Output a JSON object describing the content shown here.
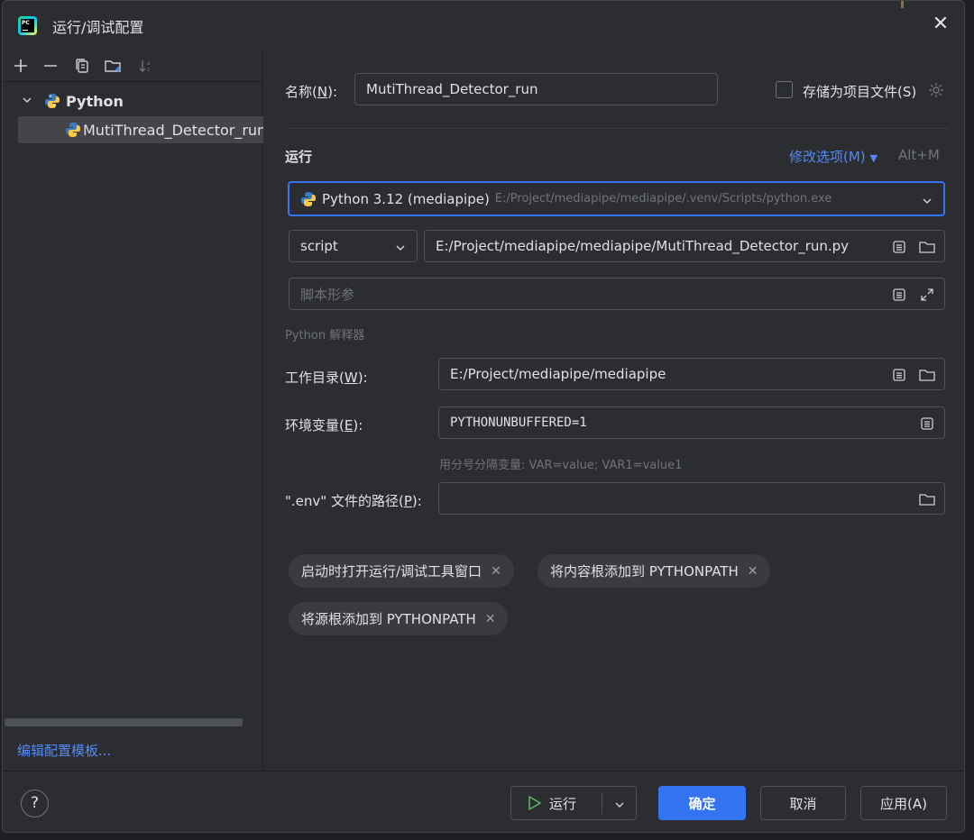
{
  "window": {
    "title": "运行/调试配置"
  },
  "sidebar": {
    "toolbar": [
      "add",
      "remove",
      "copy",
      "new-folder",
      "sort"
    ],
    "tree": [
      {
        "label": "Python",
        "expanded": true,
        "level": 0
      },
      {
        "label": "MutiThread_Detector_run",
        "selected": true,
        "level": 1
      }
    ],
    "edit_templates": "编辑配置模板..."
  },
  "form": {
    "name_label_pre": "名称(",
    "name_label_key": "N",
    "name_label_post": "):",
    "name_value": "MutiThread_Detector_run",
    "store_label": "存储为项目文件(S)",
    "run_section": "运行",
    "modify_options": "修改选项(M)",
    "modify_shortcut": "Alt+M",
    "interpreter_name": "Python 3.12 (mediapipe)",
    "interpreter_path": "E:/Project/mediapipe/mediapipe/.venv/Scripts/python.exe",
    "script_type": "script",
    "script_path": "E:/Project/mediapipe/mediapipe/MutiThread_Detector_run.py",
    "script_params_placeholder": "脚本形参",
    "interpreter_hint": "Python 解释器",
    "workdir_label_pre": "工作目录(",
    "workdir_label_key": "W",
    "workdir_label_post": "):",
    "workdir_value": "E:/Project/mediapipe/mediapipe",
    "env_label_pre": "环境变量(",
    "env_label_key": "E",
    "env_label_post": "):",
    "env_value": "PYTHONUNBUFFERED=1",
    "env_hint": "用分号分隔变量: VAR=value; VAR1=value1",
    "dotenv_label_pre": "\".env\" 文件的路径(",
    "dotenv_label_key": "P",
    "dotenv_label_post": "):",
    "dotenv_value": "",
    "chips": [
      "启动时打开运行/调试工具窗口",
      "将内容根添加到 PYTHONPATH",
      "将源根添加到 PYTHONPATH"
    ]
  },
  "footer": {
    "help": "?",
    "run": "运行",
    "ok": "确定",
    "cancel": "取消",
    "apply": "应用(A)"
  },
  "colors": {
    "accent": "#3574f0",
    "link": "#548af7",
    "bg": "#2b2d30"
  }
}
